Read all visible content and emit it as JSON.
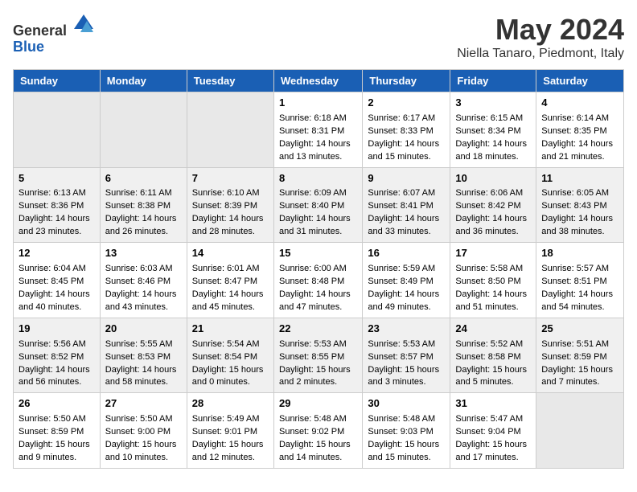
{
  "header": {
    "logo_general": "General",
    "logo_blue": "Blue",
    "month": "May 2024",
    "location": "Niella Tanaro, Piedmont, Italy"
  },
  "days_of_week": [
    "Sunday",
    "Monday",
    "Tuesday",
    "Wednesday",
    "Thursday",
    "Friday",
    "Saturday"
  ],
  "weeks": [
    [
      {
        "day": "",
        "info": ""
      },
      {
        "day": "",
        "info": ""
      },
      {
        "day": "",
        "info": ""
      },
      {
        "day": "1",
        "info": "Sunrise: 6:18 AM\nSunset: 8:31 PM\nDaylight: 14 hours\nand 13 minutes."
      },
      {
        "day": "2",
        "info": "Sunrise: 6:17 AM\nSunset: 8:33 PM\nDaylight: 14 hours\nand 15 minutes."
      },
      {
        "day": "3",
        "info": "Sunrise: 6:15 AM\nSunset: 8:34 PM\nDaylight: 14 hours\nand 18 minutes."
      },
      {
        "day": "4",
        "info": "Sunrise: 6:14 AM\nSunset: 8:35 PM\nDaylight: 14 hours\nand 21 minutes."
      }
    ],
    [
      {
        "day": "5",
        "info": "Sunrise: 6:13 AM\nSunset: 8:36 PM\nDaylight: 14 hours\nand 23 minutes."
      },
      {
        "day": "6",
        "info": "Sunrise: 6:11 AM\nSunset: 8:38 PM\nDaylight: 14 hours\nand 26 minutes."
      },
      {
        "day": "7",
        "info": "Sunrise: 6:10 AM\nSunset: 8:39 PM\nDaylight: 14 hours\nand 28 minutes."
      },
      {
        "day": "8",
        "info": "Sunrise: 6:09 AM\nSunset: 8:40 PM\nDaylight: 14 hours\nand 31 minutes."
      },
      {
        "day": "9",
        "info": "Sunrise: 6:07 AM\nSunset: 8:41 PM\nDaylight: 14 hours\nand 33 minutes."
      },
      {
        "day": "10",
        "info": "Sunrise: 6:06 AM\nSunset: 8:42 PM\nDaylight: 14 hours\nand 36 minutes."
      },
      {
        "day": "11",
        "info": "Sunrise: 6:05 AM\nSunset: 8:43 PM\nDaylight: 14 hours\nand 38 minutes."
      }
    ],
    [
      {
        "day": "12",
        "info": "Sunrise: 6:04 AM\nSunset: 8:45 PM\nDaylight: 14 hours\nand 40 minutes."
      },
      {
        "day": "13",
        "info": "Sunrise: 6:03 AM\nSunset: 8:46 PM\nDaylight: 14 hours\nand 43 minutes."
      },
      {
        "day": "14",
        "info": "Sunrise: 6:01 AM\nSunset: 8:47 PM\nDaylight: 14 hours\nand 45 minutes."
      },
      {
        "day": "15",
        "info": "Sunrise: 6:00 AM\nSunset: 8:48 PM\nDaylight: 14 hours\nand 47 minutes."
      },
      {
        "day": "16",
        "info": "Sunrise: 5:59 AM\nSunset: 8:49 PM\nDaylight: 14 hours\nand 49 minutes."
      },
      {
        "day": "17",
        "info": "Sunrise: 5:58 AM\nSunset: 8:50 PM\nDaylight: 14 hours\nand 51 minutes."
      },
      {
        "day": "18",
        "info": "Sunrise: 5:57 AM\nSunset: 8:51 PM\nDaylight: 14 hours\nand 54 minutes."
      }
    ],
    [
      {
        "day": "19",
        "info": "Sunrise: 5:56 AM\nSunset: 8:52 PM\nDaylight: 14 hours\nand 56 minutes."
      },
      {
        "day": "20",
        "info": "Sunrise: 5:55 AM\nSunset: 8:53 PM\nDaylight: 14 hours\nand 58 minutes."
      },
      {
        "day": "21",
        "info": "Sunrise: 5:54 AM\nSunset: 8:54 PM\nDaylight: 15 hours\nand 0 minutes."
      },
      {
        "day": "22",
        "info": "Sunrise: 5:53 AM\nSunset: 8:55 PM\nDaylight: 15 hours\nand 2 minutes."
      },
      {
        "day": "23",
        "info": "Sunrise: 5:53 AM\nSunset: 8:57 PM\nDaylight: 15 hours\nand 3 minutes."
      },
      {
        "day": "24",
        "info": "Sunrise: 5:52 AM\nSunset: 8:58 PM\nDaylight: 15 hours\nand 5 minutes."
      },
      {
        "day": "25",
        "info": "Sunrise: 5:51 AM\nSunset: 8:59 PM\nDaylight: 15 hours\nand 7 minutes."
      }
    ],
    [
      {
        "day": "26",
        "info": "Sunrise: 5:50 AM\nSunset: 8:59 PM\nDaylight: 15 hours\nand 9 minutes."
      },
      {
        "day": "27",
        "info": "Sunrise: 5:50 AM\nSunset: 9:00 PM\nDaylight: 15 hours\nand 10 minutes."
      },
      {
        "day": "28",
        "info": "Sunrise: 5:49 AM\nSunset: 9:01 PM\nDaylight: 15 hours\nand 12 minutes."
      },
      {
        "day": "29",
        "info": "Sunrise: 5:48 AM\nSunset: 9:02 PM\nDaylight: 15 hours\nand 14 minutes."
      },
      {
        "day": "30",
        "info": "Sunrise: 5:48 AM\nSunset: 9:03 PM\nDaylight: 15 hours\nand 15 minutes."
      },
      {
        "day": "31",
        "info": "Sunrise: 5:47 AM\nSunset: 9:04 PM\nDaylight: 15 hours\nand 17 minutes."
      },
      {
        "day": "",
        "info": ""
      }
    ]
  ]
}
